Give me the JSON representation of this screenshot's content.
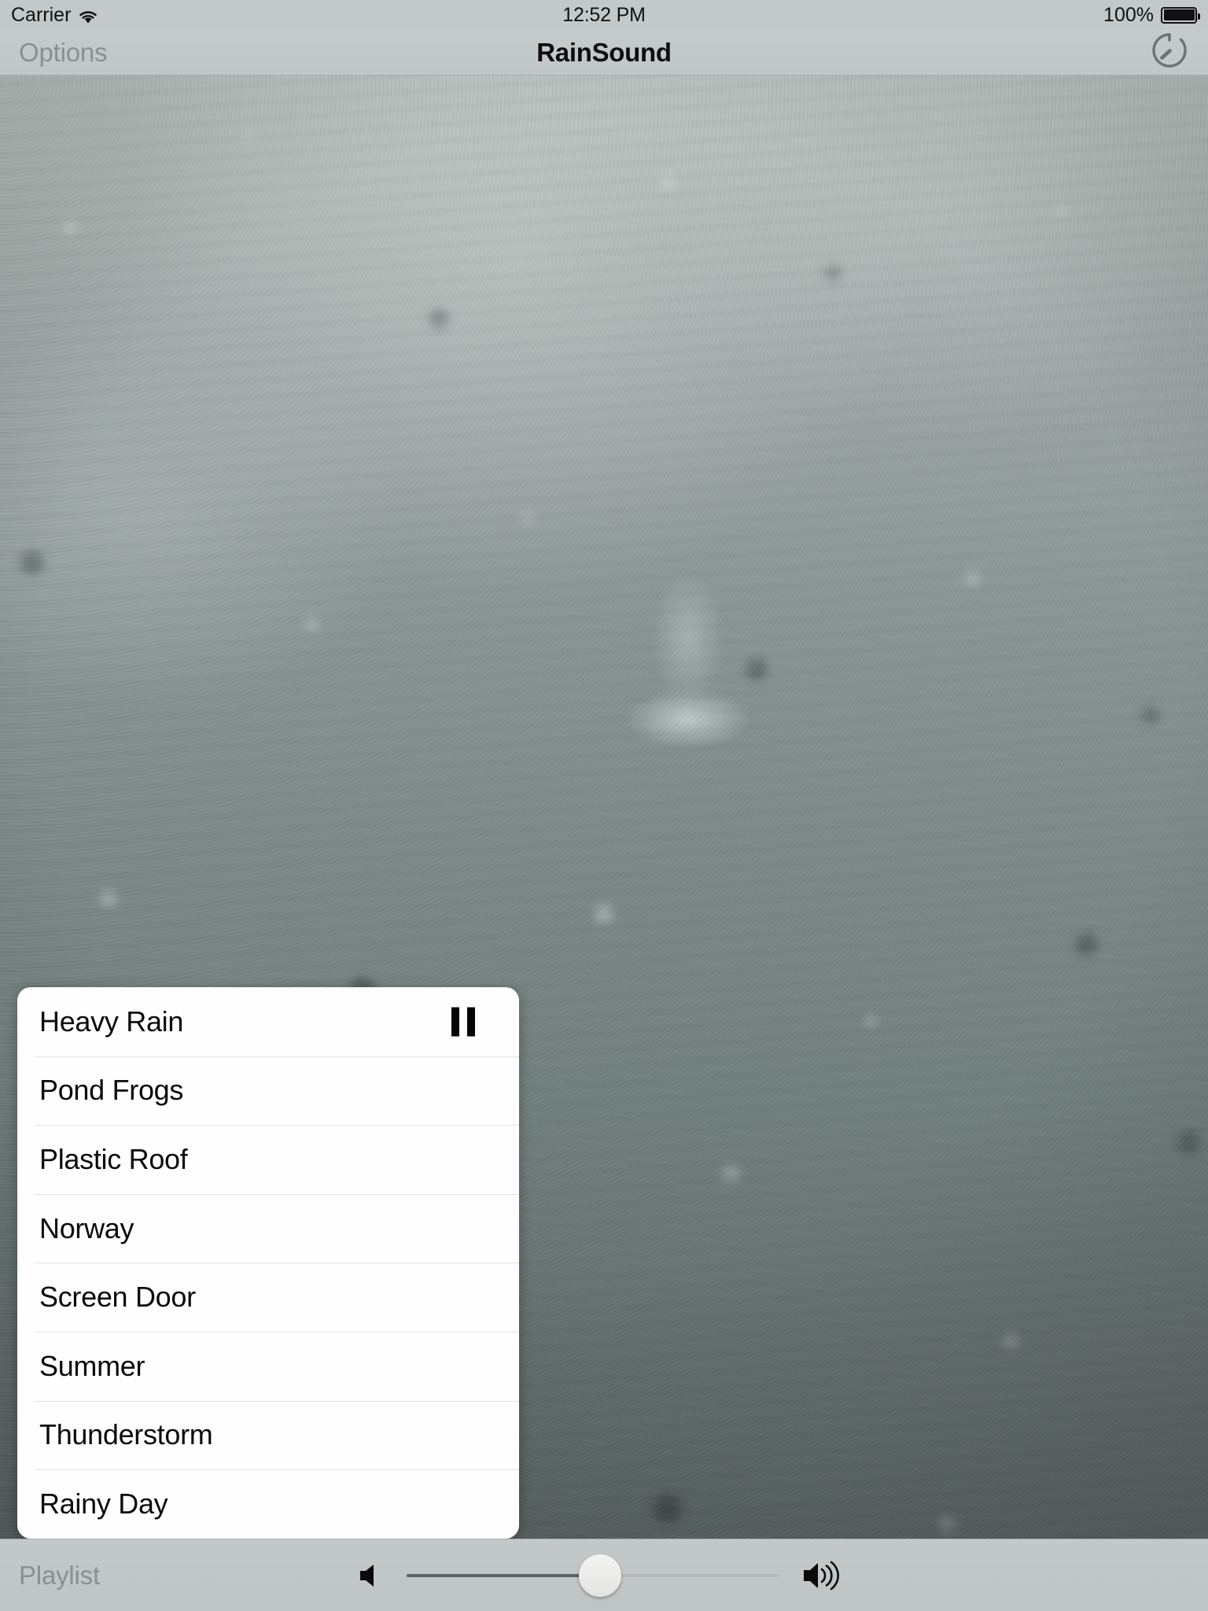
{
  "statusbar": {
    "carrier": "Carrier",
    "wifi_icon": "wifi-icon",
    "time": "12:52 PM",
    "battery_percent": "100%",
    "battery_icon": "battery-full-icon"
  },
  "navbar": {
    "left_button": "Options",
    "title": "RainSound",
    "right_icon": "timer-icon"
  },
  "background": {
    "description": "rain-falling-on-water-photo",
    "base_color": "#7d8a88"
  },
  "popover": {
    "arrow_direction": "down",
    "items": [
      {
        "label": "Heavy Rain",
        "playing": true,
        "icon": "pause-icon"
      },
      {
        "label": "Pond Frogs",
        "playing": false,
        "icon": ""
      },
      {
        "label": "Plastic Roof",
        "playing": false,
        "icon": ""
      },
      {
        "label": "Norway",
        "playing": false,
        "icon": ""
      },
      {
        "label": "Screen Door",
        "playing": false,
        "icon": ""
      },
      {
        "label": "Summer",
        "playing": false,
        "icon": ""
      },
      {
        "label": "Thunderstorm",
        "playing": false,
        "icon": ""
      },
      {
        "label": "Rainy Day",
        "playing": false,
        "icon": ""
      }
    ]
  },
  "toolbar": {
    "playlist_label": "Playlist",
    "volume_down_icon": "volume-mute-icon",
    "volume_up_icon": "volume-high-icon",
    "volume_value": 52
  },
  "colors": {
    "chrome": "#c3c8c8",
    "disabled_text": "#8b8f8f",
    "title_text": "#0d0d0d",
    "popover_bg": "#fefefe",
    "separator": "#e2e2e2",
    "slider_filled": "#5e6363",
    "slider_track": "#b3b8b8"
  }
}
